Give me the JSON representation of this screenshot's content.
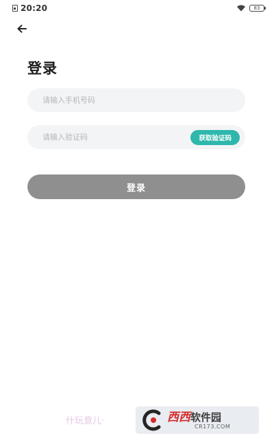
{
  "status_bar": {
    "time": "20:20",
    "battery": "83"
  },
  "login": {
    "title": "登录",
    "phone_placeholder": "请输入手机号码",
    "code_placeholder": "请输入验证码",
    "get_code_label": "获取验证码",
    "submit_label": "登录"
  },
  "footer": {
    "text": "什玩意儿·"
  },
  "watermark": {
    "main": "西西",
    "main_suffix": "软件园",
    "sub": "CR173.COM"
  },
  "colors": {
    "accent": "#2fb7ac",
    "login_button": "#8f8f8f",
    "field_bg": "#f3f4f6"
  }
}
